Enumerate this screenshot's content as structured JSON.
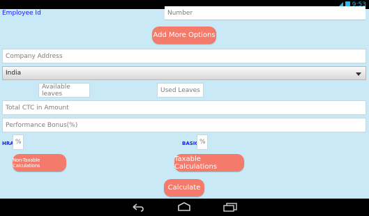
{
  "status": {
    "time": "9:53"
  },
  "form": {
    "employee_id_label": "Employee Id",
    "number_placeholder": "Number",
    "add_more_options": "Add More Options",
    "company_address_placeholder": "Company Address",
    "country_selected": "India",
    "available_leaves_placeholder": "Available leaves",
    "used_leaves_placeholder": "Used Leaves",
    "total_ctc_placeholder": "Total CTC in Amount",
    "performance_bonus_placeholder": "Performance Bonus(%)",
    "hra_label": "HRA",
    "hra_unit": "%",
    "basic_label": "BASIC",
    "basic_unit": "%",
    "non_taxable_button": "Non-Taxable Calculations",
    "taxable_button": "Taxable Calculations",
    "calculate_button": "Calculate"
  },
  "icons": {
    "signal": "signal-icon",
    "battery": "battery-icon",
    "back": "back-icon",
    "home": "home-icon",
    "recents": "recents-icon"
  }
}
